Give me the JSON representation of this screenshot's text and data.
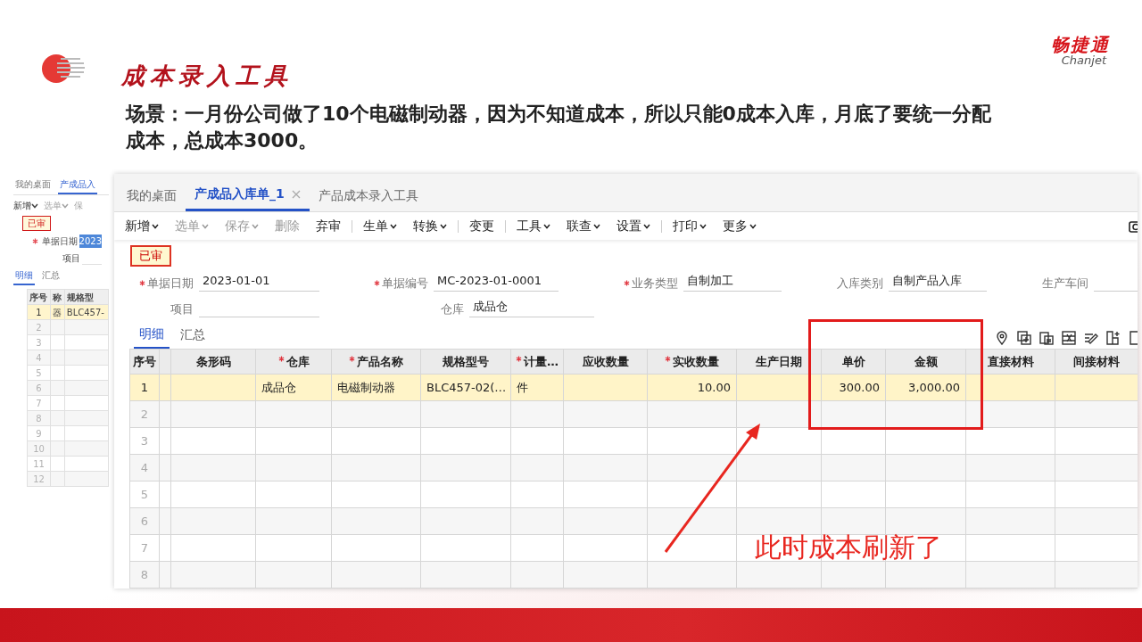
{
  "slide": {
    "title": "成本录入工具",
    "brand_name": "畅捷通",
    "brand_latin": "Chanjet",
    "text": "场景：一月份公司做了10个电磁制动器，因为不知道成本，所以只能0成本入库，月底了要统一分配成本，总成本3000。"
  },
  "background_window": {
    "tabs": [
      {
        "label": "我的桌面",
        "selected": false
      },
      {
        "label": "产成品入",
        "selected": true
      }
    ],
    "toolbar": [
      {
        "label": "新增",
        "dropdown": true,
        "disabled": false
      },
      {
        "label": "选单",
        "dropdown": true,
        "disabled": true
      },
      {
        "label": "保",
        "dropdown": false,
        "disabled": true
      }
    ],
    "status": "已审",
    "fields": [
      {
        "label": "单据日期",
        "value": "2023",
        "required": true,
        "selected": true
      },
      {
        "label": "项目",
        "required": false,
        "selected": false
      }
    ],
    "subtabs": [
      {
        "label": "明细",
        "selected": true
      },
      {
        "label": "汇总",
        "selected": false
      }
    ],
    "columns": [
      "序号",
      "称",
      "规格型"
    ],
    "rows": [
      {
        "cells": [
          "1",
          "器",
          "BLC457-"
        ],
        "selected": true
      },
      {
        "cells": [
          "2"
        ],
        "selected": false
      },
      {
        "cells": [
          "3"
        ],
        "selected": false
      },
      {
        "cells": [
          "4"
        ],
        "selected": false
      },
      {
        "cells": [
          "5"
        ],
        "selected": false
      },
      {
        "cells": [
          "6"
        ],
        "selected": false
      },
      {
        "cells": [
          "7"
        ],
        "selected": false
      },
      {
        "cells": [
          "8"
        ],
        "selected": false
      },
      {
        "cells": [
          "9"
        ],
        "selected": false
      },
      {
        "cells": [
          "10"
        ],
        "selected": false
      },
      {
        "cells": [
          "11"
        ],
        "selected": false
      },
      {
        "cells": [
          "12"
        ],
        "selected": false
      }
    ]
  },
  "window": {
    "tabs": [
      {
        "label": "我的桌面",
        "selected": false,
        "closable": false
      },
      {
        "label": "产成品入库单_1",
        "selected": true,
        "closable": true
      },
      {
        "label": "产品成本录入工具",
        "selected": false,
        "closable": false
      }
    ],
    "toolbar": [
      {
        "kind": "button",
        "label": "新增",
        "dropdown": true,
        "disabled": false
      },
      {
        "kind": "button",
        "label": "选单",
        "dropdown": true,
        "disabled": true
      },
      {
        "kind": "button",
        "label": "保存",
        "dropdown": true,
        "disabled": true
      },
      {
        "kind": "button",
        "label": "删除",
        "dropdown": false,
        "disabled": true
      },
      {
        "kind": "button",
        "label": "弃审",
        "dropdown": false,
        "disabled": false
      },
      {
        "kind": "separator"
      },
      {
        "kind": "button",
        "label": "生单",
        "dropdown": true,
        "disabled": false
      },
      {
        "kind": "button",
        "label": "转换",
        "dropdown": true,
        "disabled": false
      },
      {
        "kind": "separator"
      },
      {
        "kind": "button",
        "label": "变更",
        "dropdown": false,
        "disabled": false
      },
      {
        "kind": "separator"
      },
      {
        "kind": "button",
        "label": "工具",
        "dropdown": true,
        "disabled": false
      },
      {
        "kind": "button",
        "label": "联查",
        "dropdown": true,
        "disabled": false
      },
      {
        "kind": "button",
        "label": "设置",
        "dropdown": true,
        "disabled": false
      },
      {
        "kind": "separator"
      },
      {
        "kind": "button",
        "label": "打印",
        "dropdown": true,
        "disabled": false
      },
      {
        "kind": "button",
        "label": "更多",
        "dropdown": true,
        "disabled": false
      }
    ],
    "status": "已审",
    "fields": [
      [
        {
          "label": "单据日期",
          "value": "2023-01-01",
          "required": true
        },
        {
          "label": "单据编号",
          "value": "MC-2023-01-0001",
          "required": true
        },
        {
          "label": "业务类型",
          "value": "自制加工",
          "required": true
        },
        {
          "label": "入库类别",
          "value": "自制产品入库",
          "required": false
        },
        {
          "label": "生产车间",
          "required": false
        }
      ],
      [
        {
          "label": "项目",
          "required": false
        },
        {
          "label": "仓库",
          "value": "成品仓",
          "required": false
        }
      ]
    ],
    "subtabs": [
      {
        "label": "明细",
        "selected": true
      },
      {
        "label": "汇总",
        "selected": false
      }
    ],
    "table": {
      "columns": [
        {
          "label": "序号",
          "required": false
        },
        {},
        {
          "label": "条形码",
          "required": false
        },
        {
          "label": "仓库",
          "required": true,
          "numeric": false
        },
        {
          "label": "产品名称",
          "required": true,
          "numeric": false
        },
        {
          "label": "规格型号",
          "required": false
        },
        {
          "label": "计量…",
          "required": true,
          "numeric": false
        },
        {
          "label": "应收数量",
          "required": false
        },
        {
          "label": "实收数量",
          "required": true,
          "numeric": true
        },
        {
          "label": "生产日期",
          "required": false
        },
        {
          "label": "单价",
          "required": false,
          "numeric": true
        },
        {
          "label": "金额",
          "required": false,
          "numeric": true
        },
        {
          "label": "直接材料",
          "required": false
        },
        {
          "label": "间接材料",
          "required": false
        }
      ],
      "rows": [
        {
          "cells": [
            "1",
            null,
            null,
            "成品仓",
            "电磁制动器",
            "BLC457-02(…",
            "件",
            null,
            "10.00",
            null,
            "300.00",
            "3,000.00",
            null,
            null
          ],
          "selected": true
        },
        {
          "cells": [
            "2"
          ],
          "selected": false
        },
        {
          "cells": [
            "3"
          ],
          "selected": false
        },
        {
          "cells": [
            "4"
          ],
          "selected": false
        },
        {
          "cells": [
            "5"
          ],
          "selected": false
        },
        {
          "cells": [
            "6"
          ],
          "selected": false
        },
        {
          "cells": [
            "7"
          ],
          "selected": false
        },
        {
          "cells": [
            "8"
          ],
          "selected": false
        }
      ]
    }
  },
  "annotation": {
    "text": "此时成本刷新了"
  }
}
